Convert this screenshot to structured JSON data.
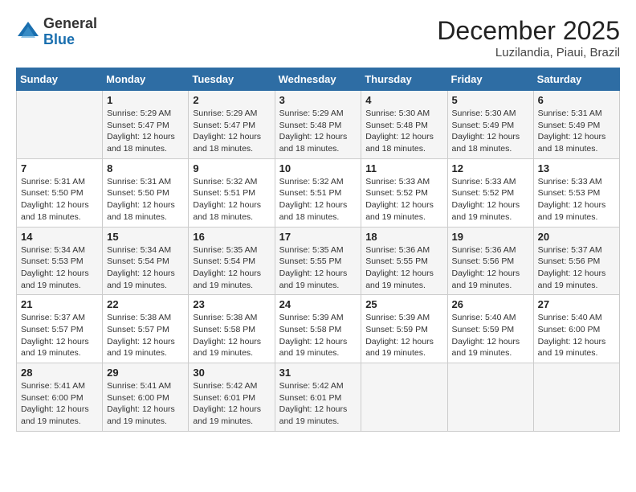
{
  "logo": {
    "general": "General",
    "blue": "Blue"
  },
  "title": {
    "month_year": "December 2025",
    "location": "Luzilandia, Piaui, Brazil"
  },
  "header": {
    "days": [
      "Sunday",
      "Monday",
      "Tuesday",
      "Wednesday",
      "Thursday",
      "Friday",
      "Saturday"
    ]
  },
  "weeks": [
    [
      {
        "day": "",
        "info": ""
      },
      {
        "day": "1",
        "info": "Sunrise: 5:29 AM\nSunset: 5:47 PM\nDaylight: 12 hours\nand 18 minutes."
      },
      {
        "day": "2",
        "info": "Sunrise: 5:29 AM\nSunset: 5:47 PM\nDaylight: 12 hours\nand 18 minutes."
      },
      {
        "day": "3",
        "info": "Sunrise: 5:29 AM\nSunset: 5:48 PM\nDaylight: 12 hours\nand 18 minutes."
      },
      {
        "day": "4",
        "info": "Sunrise: 5:30 AM\nSunset: 5:48 PM\nDaylight: 12 hours\nand 18 minutes."
      },
      {
        "day": "5",
        "info": "Sunrise: 5:30 AM\nSunset: 5:49 PM\nDaylight: 12 hours\nand 18 minutes."
      },
      {
        "day": "6",
        "info": "Sunrise: 5:31 AM\nSunset: 5:49 PM\nDaylight: 12 hours\nand 18 minutes."
      }
    ],
    [
      {
        "day": "7",
        "info": "Sunrise: 5:31 AM\nSunset: 5:50 PM\nDaylight: 12 hours\nand 18 minutes."
      },
      {
        "day": "8",
        "info": "Sunrise: 5:31 AM\nSunset: 5:50 PM\nDaylight: 12 hours\nand 18 minutes."
      },
      {
        "day": "9",
        "info": "Sunrise: 5:32 AM\nSunset: 5:51 PM\nDaylight: 12 hours\nand 18 minutes."
      },
      {
        "day": "10",
        "info": "Sunrise: 5:32 AM\nSunset: 5:51 PM\nDaylight: 12 hours\nand 18 minutes."
      },
      {
        "day": "11",
        "info": "Sunrise: 5:33 AM\nSunset: 5:52 PM\nDaylight: 12 hours\nand 19 minutes."
      },
      {
        "day": "12",
        "info": "Sunrise: 5:33 AM\nSunset: 5:52 PM\nDaylight: 12 hours\nand 19 minutes."
      },
      {
        "day": "13",
        "info": "Sunrise: 5:33 AM\nSunset: 5:53 PM\nDaylight: 12 hours\nand 19 minutes."
      }
    ],
    [
      {
        "day": "14",
        "info": "Sunrise: 5:34 AM\nSunset: 5:53 PM\nDaylight: 12 hours\nand 19 minutes."
      },
      {
        "day": "15",
        "info": "Sunrise: 5:34 AM\nSunset: 5:54 PM\nDaylight: 12 hours\nand 19 minutes."
      },
      {
        "day": "16",
        "info": "Sunrise: 5:35 AM\nSunset: 5:54 PM\nDaylight: 12 hours\nand 19 minutes."
      },
      {
        "day": "17",
        "info": "Sunrise: 5:35 AM\nSunset: 5:55 PM\nDaylight: 12 hours\nand 19 minutes."
      },
      {
        "day": "18",
        "info": "Sunrise: 5:36 AM\nSunset: 5:55 PM\nDaylight: 12 hours\nand 19 minutes."
      },
      {
        "day": "19",
        "info": "Sunrise: 5:36 AM\nSunset: 5:56 PM\nDaylight: 12 hours\nand 19 minutes."
      },
      {
        "day": "20",
        "info": "Sunrise: 5:37 AM\nSunset: 5:56 PM\nDaylight: 12 hours\nand 19 minutes."
      }
    ],
    [
      {
        "day": "21",
        "info": "Sunrise: 5:37 AM\nSunset: 5:57 PM\nDaylight: 12 hours\nand 19 minutes."
      },
      {
        "day": "22",
        "info": "Sunrise: 5:38 AM\nSunset: 5:57 PM\nDaylight: 12 hours\nand 19 minutes."
      },
      {
        "day": "23",
        "info": "Sunrise: 5:38 AM\nSunset: 5:58 PM\nDaylight: 12 hours\nand 19 minutes."
      },
      {
        "day": "24",
        "info": "Sunrise: 5:39 AM\nSunset: 5:58 PM\nDaylight: 12 hours\nand 19 minutes."
      },
      {
        "day": "25",
        "info": "Sunrise: 5:39 AM\nSunset: 5:59 PM\nDaylight: 12 hours\nand 19 minutes."
      },
      {
        "day": "26",
        "info": "Sunrise: 5:40 AM\nSunset: 5:59 PM\nDaylight: 12 hours\nand 19 minutes."
      },
      {
        "day": "27",
        "info": "Sunrise: 5:40 AM\nSunset: 6:00 PM\nDaylight: 12 hours\nand 19 minutes."
      }
    ],
    [
      {
        "day": "28",
        "info": "Sunrise: 5:41 AM\nSunset: 6:00 PM\nDaylight: 12 hours\nand 19 minutes."
      },
      {
        "day": "29",
        "info": "Sunrise: 5:41 AM\nSunset: 6:00 PM\nDaylight: 12 hours\nand 19 minutes."
      },
      {
        "day": "30",
        "info": "Sunrise: 5:42 AM\nSunset: 6:01 PM\nDaylight: 12 hours\nand 19 minutes."
      },
      {
        "day": "31",
        "info": "Sunrise: 5:42 AM\nSunset: 6:01 PM\nDaylight: 12 hours\nand 19 minutes."
      },
      {
        "day": "",
        "info": ""
      },
      {
        "day": "",
        "info": ""
      },
      {
        "day": "",
        "info": ""
      }
    ]
  ]
}
